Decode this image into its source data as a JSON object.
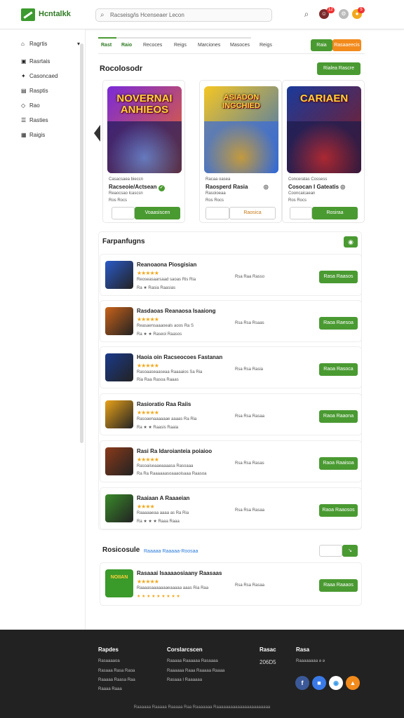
{
  "header": {
    "brand": "Hcntalkk",
    "search_placeholder": "Racseisg/is Hcenseaer Lecon",
    "notif_count": "12",
    "cart_count": "5"
  },
  "sidebar": {
    "items": [
      {
        "label": "Ragrtis",
        "icon": "home-icon",
        "chevron": "▾"
      },
      {
        "label": "Rasrtais",
        "icon": "grid-icon"
      },
      {
        "label": "Casoncaed",
        "icon": "gamepad-icon"
      },
      {
        "label": "Rasptis",
        "icon": "chart-icon"
      },
      {
        "label": "Rao",
        "icon": "tag-icon"
      },
      {
        "label": "Rasties",
        "icon": "list-icon"
      },
      {
        "label": "Raigis",
        "icon": "news-icon"
      }
    ]
  },
  "tabs": {
    "items": [
      "Rast",
      "Raio",
      "Recoces",
      "Reigs",
      "Marciones",
      "Masoces",
      "Reigs"
    ],
    "active_index": 0,
    "btn_primary": "Raia",
    "btn_secondary": "Rasaaeecis"
  },
  "recommended": {
    "title": "Rocolosodr",
    "see_all": "Rialea Rascre",
    "cards": [
      {
        "art_title": "NOVERNAI ANHIEOS",
        "category": "Casacsaea bieccn",
        "name": "Racseoie/Actsean",
        "meta": "Reaocsao lcascsn",
        "meta2": "Ros Rocs",
        "button": "Voaasiscen",
        "button_style": "green",
        "badge": "✓",
        "thumb_color1": "#7a2ad8",
        "thumb_color2": "#f26a1c"
      },
      {
        "art_title": "ASIADON INGCHIED",
        "category": "Racaa oasea",
        "name": "Raosperd Rasia",
        "meta": "Rasoioeaa",
        "meta2": "Ros Rocs",
        "button": "Raosica",
        "button_style": "outline",
        "badge": "◎",
        "thumb_color1": "#f5a623",
        "thumb_color2": "#2a6ac8"
      },
      {
        "art_title": "CARIAEN",
        "category": "Conceratas Cossess",
        "name": "Cosocan I Gateatis",
        "meta": "Cooncaicaean",
        "meta2": "Ros Rocs",
        "button": "Rosiraa",
        "button_style": "green",
        "badge": "◎",
        "thumb_color1": "#1a3a9a",
        "thumb_color2": "#8a1a1a"
      }
    ]
  },
  "list": {
    "title": "Farpanfugns",
    "rows": [
      {
        "name": "Reanoaona Piosgisian",
        "stars": "★★★★★",
        "desc": "Reoseasaarsaad saoas  Ris Ria",
        "tags": "Ra  ★ Rasia Raasias",
        "stat": "Rsa Raa Rasso",
        "button": "Rasa Raasos",
        "thumb_color": "#2a5ac8"
      },
      {
        "name": "Rasdaoas Reanaosa Isaaiong",
        "stars": "★★★★★",
        "desc": "Reasaensaaaoeals aoos Ra S",
        "tags": "Ra  ★ ★ Raseoi Raasos",
        "stat": "Rsa Rsa Rsaas",
        "button": "Raoa Raesoa",
        "thumb_color": "#c8621a"
      },
      {
        "name": "Haoia oin Racseocoes Fastanan",
        "stars": "★★★★★",
        "desc": "Rasoaaseaaseaa Raaaaios Sa Ria",
        "tags": "Ria  Raa  Rasoa  Raaas",
        "stat": "Rsa Rsa Rasia",
        "button": "Raoa Rasoca",
        "thumb_color": "#1a3a8a"
      },
      {
        "name": "Rasioratio Raa Raiis",
        "stars": "★★★★★",
        "desc": "Rasoaenaaaaaae aaaas  Ra Ria",
        "tags": "Ra  ★ ★ Raasis Raaia",
        "stat": "Rsa Rsa Rasaa",
        "button": "Raoa Raaona",
        "thumb_color": "#e8a21a"
      },
      {
        "name": "Rasi Ra Idaroianteia poiaioo",
        "stars": "★★★★★",
        "desc": "Rasoaiseaaeaaaasa Rasoaaa",
        "tags": "Ra  Ra  Raaaaaasoaaaoisaaa Raasoa",
        "stat": "Rsa Rsa Rasas",
        "button": "Raoa Raaisoa",
        "thumb_color": "#8a3a1a"
      },
      {
        "name": "Raaiaan A Raaaeian",
        "stars": "★★★★",
        "desc": "Raaaaaeaa aaaa as  Ra Ria",
        "tags": "Ra  ★ ★ ★ Raaa Raaa",
        "stat": "Rsa Rsa Rasaa",
        "button": "Raoa Raaosos",
        "thumb_color": "#3a8a2a"
      }
    ]
  },
  "popular": {
    "title": "Rosicosule",
    "subtitle": "Raaaaa Raaaaa-Roosaa",
    "row": {
      "name": "Rasaaai Isaaaaosiaany Raasaas",
      "stars": "★★★★★",
      "desc": "Raaaasaaaaaaaeaaaaa aaas Ria Raa",
      "tags": "★ ★ ★ ★ ★ ★ ★ ★ ★",
      "stat": "Rsa Rsa Rasaa",
      "button": "Raaa Raaaos",
      "art_text": "NOIIAN",
      "thumb_color": "#3a9a2a"
    }
  },
  "footer": {
    "col1": {
      "head": "Rapdes",
      "links": [
        "Rasaaaaoa",
        "Rasaaa Rasa Raoa",
        "Raaaaa Raasa Raa",
        "Raaaa Raaa"
      ]
    },
    "col2": {
      "head": "Corslarcscen",
      "links": [
        "Raaaaa Raaaaaa Rasaaaa",
        "Raaaaaa Raaa Raaaaa Raaaa",
        "Rasaaa I Raaaaaa"
      ]
    },
    "col3": {
      "head": "Rasac",
      "value": "206D5"
    },
    "col4": {
      "head": "Rasa",
      "value": "Raaaaaaaa  ə  ə"
    },
    "copyright": "Raaaaaa  Raaaaa  Raaaaa  Raa  Raaaaaaa  Raaaaaaaaaaaaaaaaaaaaaaa",
    "social": [
      {
        "icon": "f",
        "color": "#3b5998"
      },
      {
        "icon": "■",
        "color": "#3a7ae8"
      },
      {
        "icon": "◉",
        "color": "#fff"
      },
      {
        "icon": "▲",
        "color": "#f28a1c"
      }
    ]
  }
}
